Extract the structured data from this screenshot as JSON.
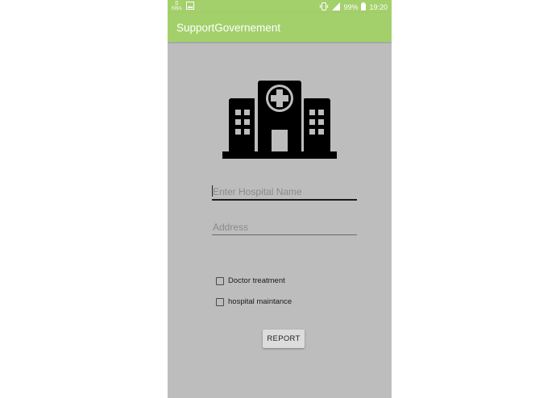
{
  "status_bar": {
    "net_speed_value": "0",
    "net_speed_unit": "KB/s",
    "battery": "99%",
    "time": "19:20"
  },
  "app_bar": {
    "title": "SupportGovernement"
  },
  "form": {
    "hospital_name_placeholder": "Enter Hospital Name",
    "address_placeholder": "Address",
    "checkbox_doctor": "Doctor treatment",
    "checkbox_maintenance": "hospital maintance",
    "report_label": "REPORT"
  },
  "colors": {
    "app_bar": "#a3d06b",
    "background": "#bdbdbd",
    "button": "#dcdcdc"
  },
  "icons": [
    "image-icon",
    "vibrate-icon",
    "signal-icon",
    "battery-icon",
    "hospital-icon"
  ]
}
